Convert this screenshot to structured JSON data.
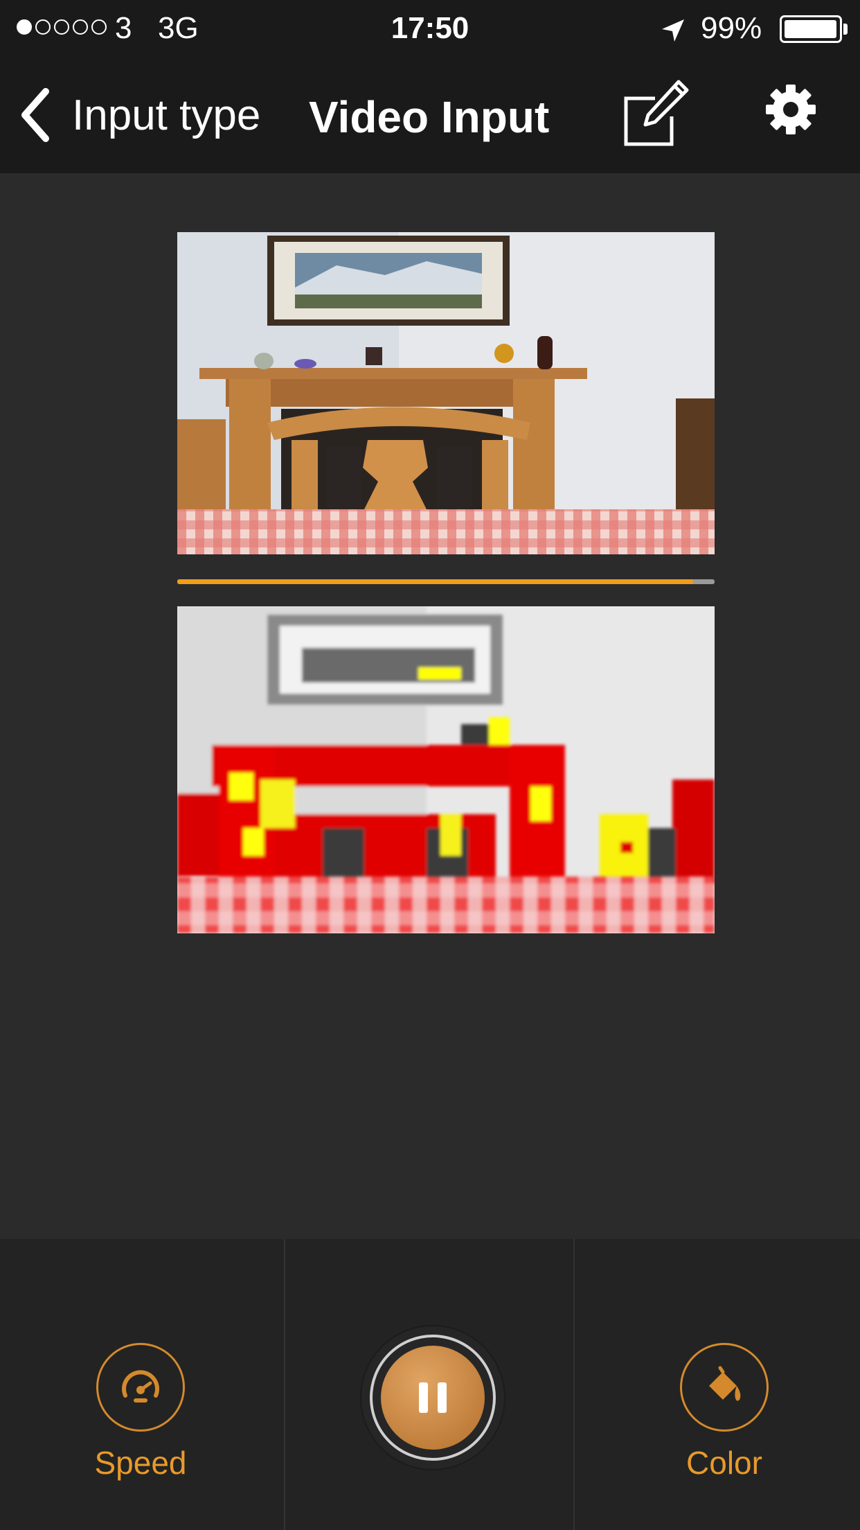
{
  "status": {
    "signal_bars_filled": 1,
    "signal_bars_total": 5,
    "carrier": "3",
    "network": "3G",
    "time": "17:50",
    "location_icon": "location-arrow-icon",
    "battery_percent": "99%",
    "battery_level": 0.99
  },
  "nav": {
    "back_label": "Input type",
    "back_icon": "chevron-left-icon",
    "title": "Video Input",
    "edit_icon": "compose-icon",
    "settings_icon": "gear-icon"
  },
  "playback": {
    "progress": 0.96,
    "progress_color": "#f09d1c"
  },
  "toolbar": {
    "speed_label": "Speed",
    "speed_icon": "speedometer-icon",
    "play_icon": "pause-icon",
    "color_label": "Color",
    "color_icon": "paint-bucket-icon",
    "accent": "#e89a2a"
  }
}
